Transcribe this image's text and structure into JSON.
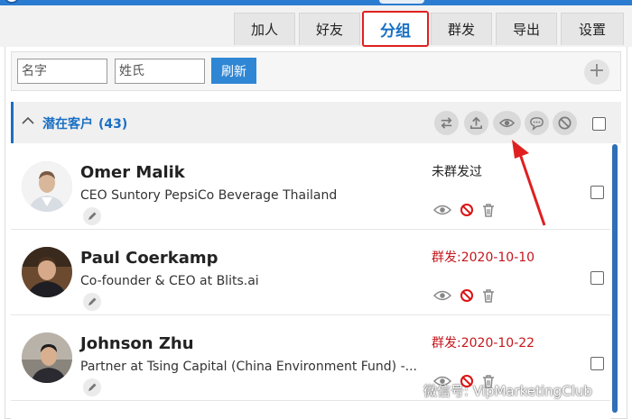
{
  "tabs": [
    {
      "label": "加人"
    },
    {
      "label": "好友"
    },
    {
      "label": "分组"
    },
    {
      "label": "群发"
    },
    {
      "label": "导出"
    },
    {
      "label": "设置"
    }
  ],
  "search": {
    "name_placeholder": "名字",
    "surname_placeholder": "姓氏",
    "refresh_label": "刷新",
    "add_label": "+"
  },
  "group": {
    "name": "潜在客户",
    "count": "(43)"
  },
  "contacts": [
    {
      "name": "Omer Malik",
      "title": "CEO Suntory PepsiCo Beverage Thailand",
      "status": "未群发过"
    },
    {
      "name": "Paul Coerkamp",
      "title": "Co-founder & CEO at Blits.ai",
      "status": "群发:2020-10-10"
    },
    {
      "name": "Johnson Zhu",
      "title": "Partner at Tsing Capital (China Environment Fund) -...",
      "status": "群发:2020-10-22"
    }
  ],
  "watermark": "微信号: VipMarketingClub",
  "colors": {
    "accent": "#1a6fc4",
    "highlight": "#e02020",
    "sent_status": "#c4161c"
  }
}
